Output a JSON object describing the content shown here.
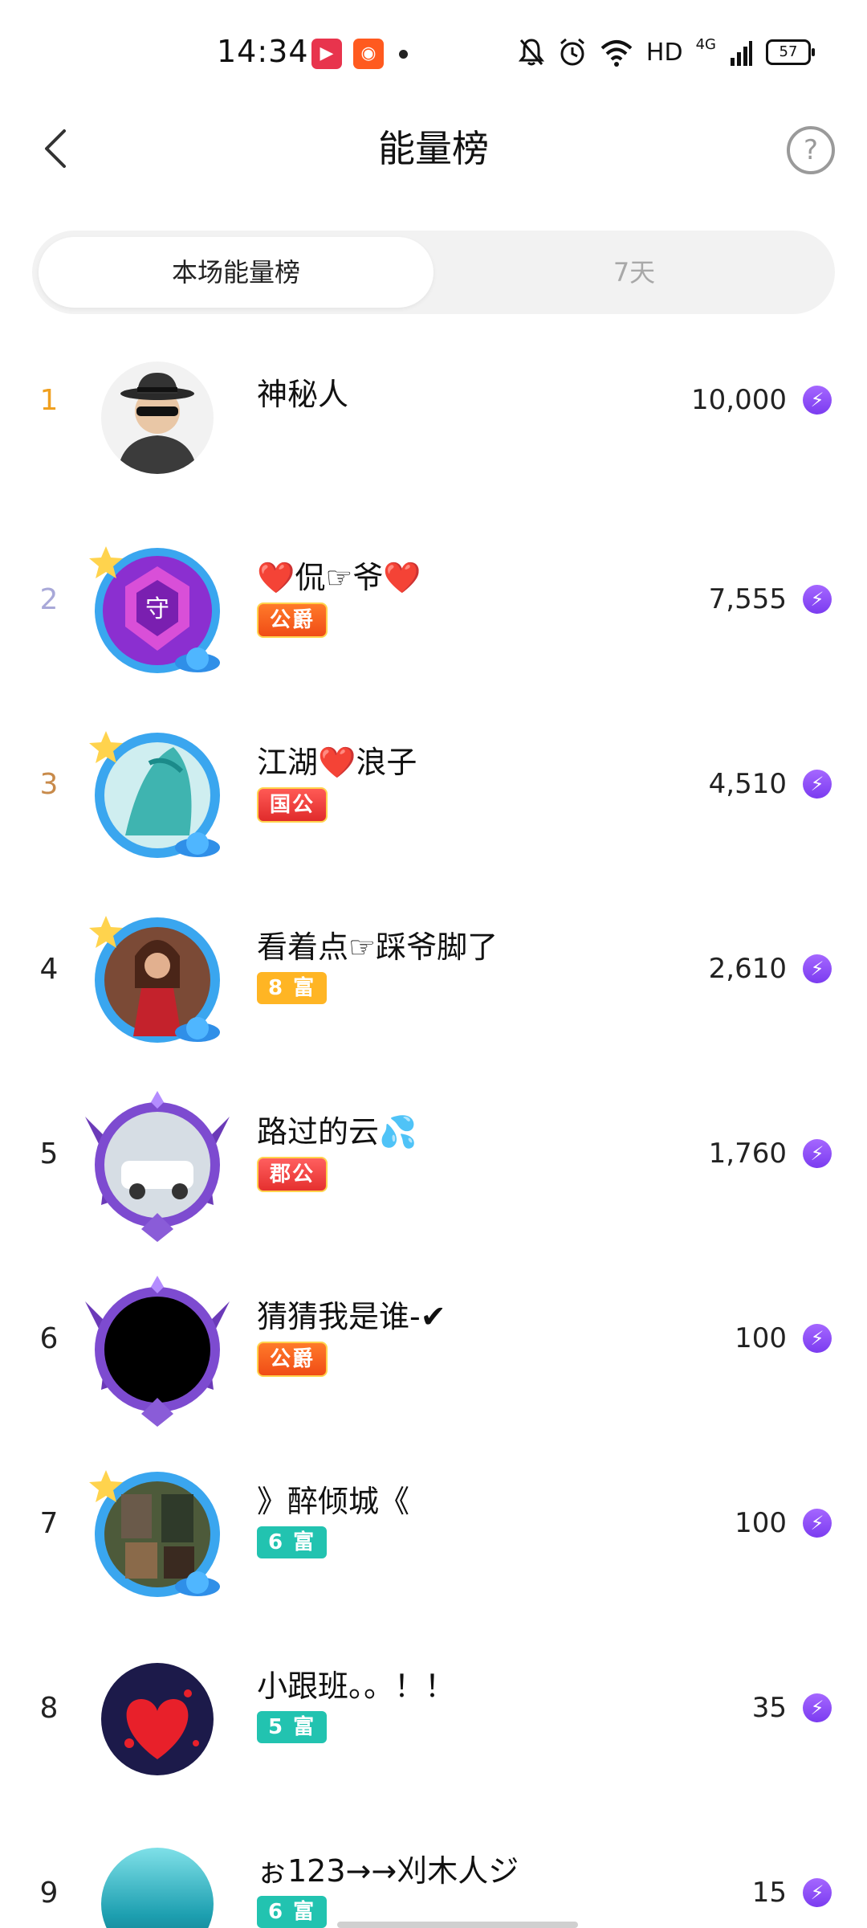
{
  "status_bar": {
    "time": "14:34",
    "network": "HD",
    "signal": "4G",
    "battery": "57"
  },
  "header": {
    "title": "能量榜",
    "help": "?"
  },
  "tabs": [
    {
      "label": "本场能量榜",
      "active": true
    },
    {
      "label": "7天",
      "active": false
    }
  ],
  "ranking": [
    {
      "rank": "1",
      "name": "神秘人",
      "badge": "",
      "score": "10,000",
      "rank_color": "#f0a020"
    },
    {
      "rank": "2",
      "name": "❤️侃☞爷❤️",
      "badge": "公爵",
      "badge_type": "gong",
      "score": "7,555",
      "rank_color": "#a8a8d8"
    },
    {
      "rank": "3",
      "name": "江湖❤️浪子",
      "badge": "国公",
      "badge_type": "guo",
      "score": "4,510",
      "rank_color": "#c88a4a"
    },
    {
      "rank": "4",
      "name": "看着点☞踩爷脚了",
      "badge": "8 富",
      "badge_type": "fu8",
      "score": "2,610",
      "rank_color": "#222222"
    },
    {
      "rank": "5",
      "name": "路过的云💦",
      "badge": "郡公",
      "badge_type": "jun",
      "score": "1,760",
      "rank_color": "#222222"
    },
    {
      "rank": "6",
      "name": "猜猜我是谁-✔",
      "badge": "公爵",
      "badge_type": "gong",
      "score": "100",
      "rank_color": "#222222"
    },
    {
      "rank": "7",
      "name": "》醉倾城《",
      "badge": "6 富",
      "badge_type": "fu6",
      "score": "100",
      "rank_color": "#222222"
    },
    {
      "rank": "8",
      "name": "小跟班。。！！",
      "badge": "5 富",
      "badge_type": "fu5",
      "score": "35",
      "rank_color": "#222222"
    },
    {
      "rank": "9",
      "name": "ぉ123→→刈木人ジ",
      "badge": "6 富",
      "badge_type": "fu6",
      "score": "15",
      "rank_color": "#222222"
    }
  ],
  "icons": {
    "energy": "lightning-bolt-icon"
  }
}
